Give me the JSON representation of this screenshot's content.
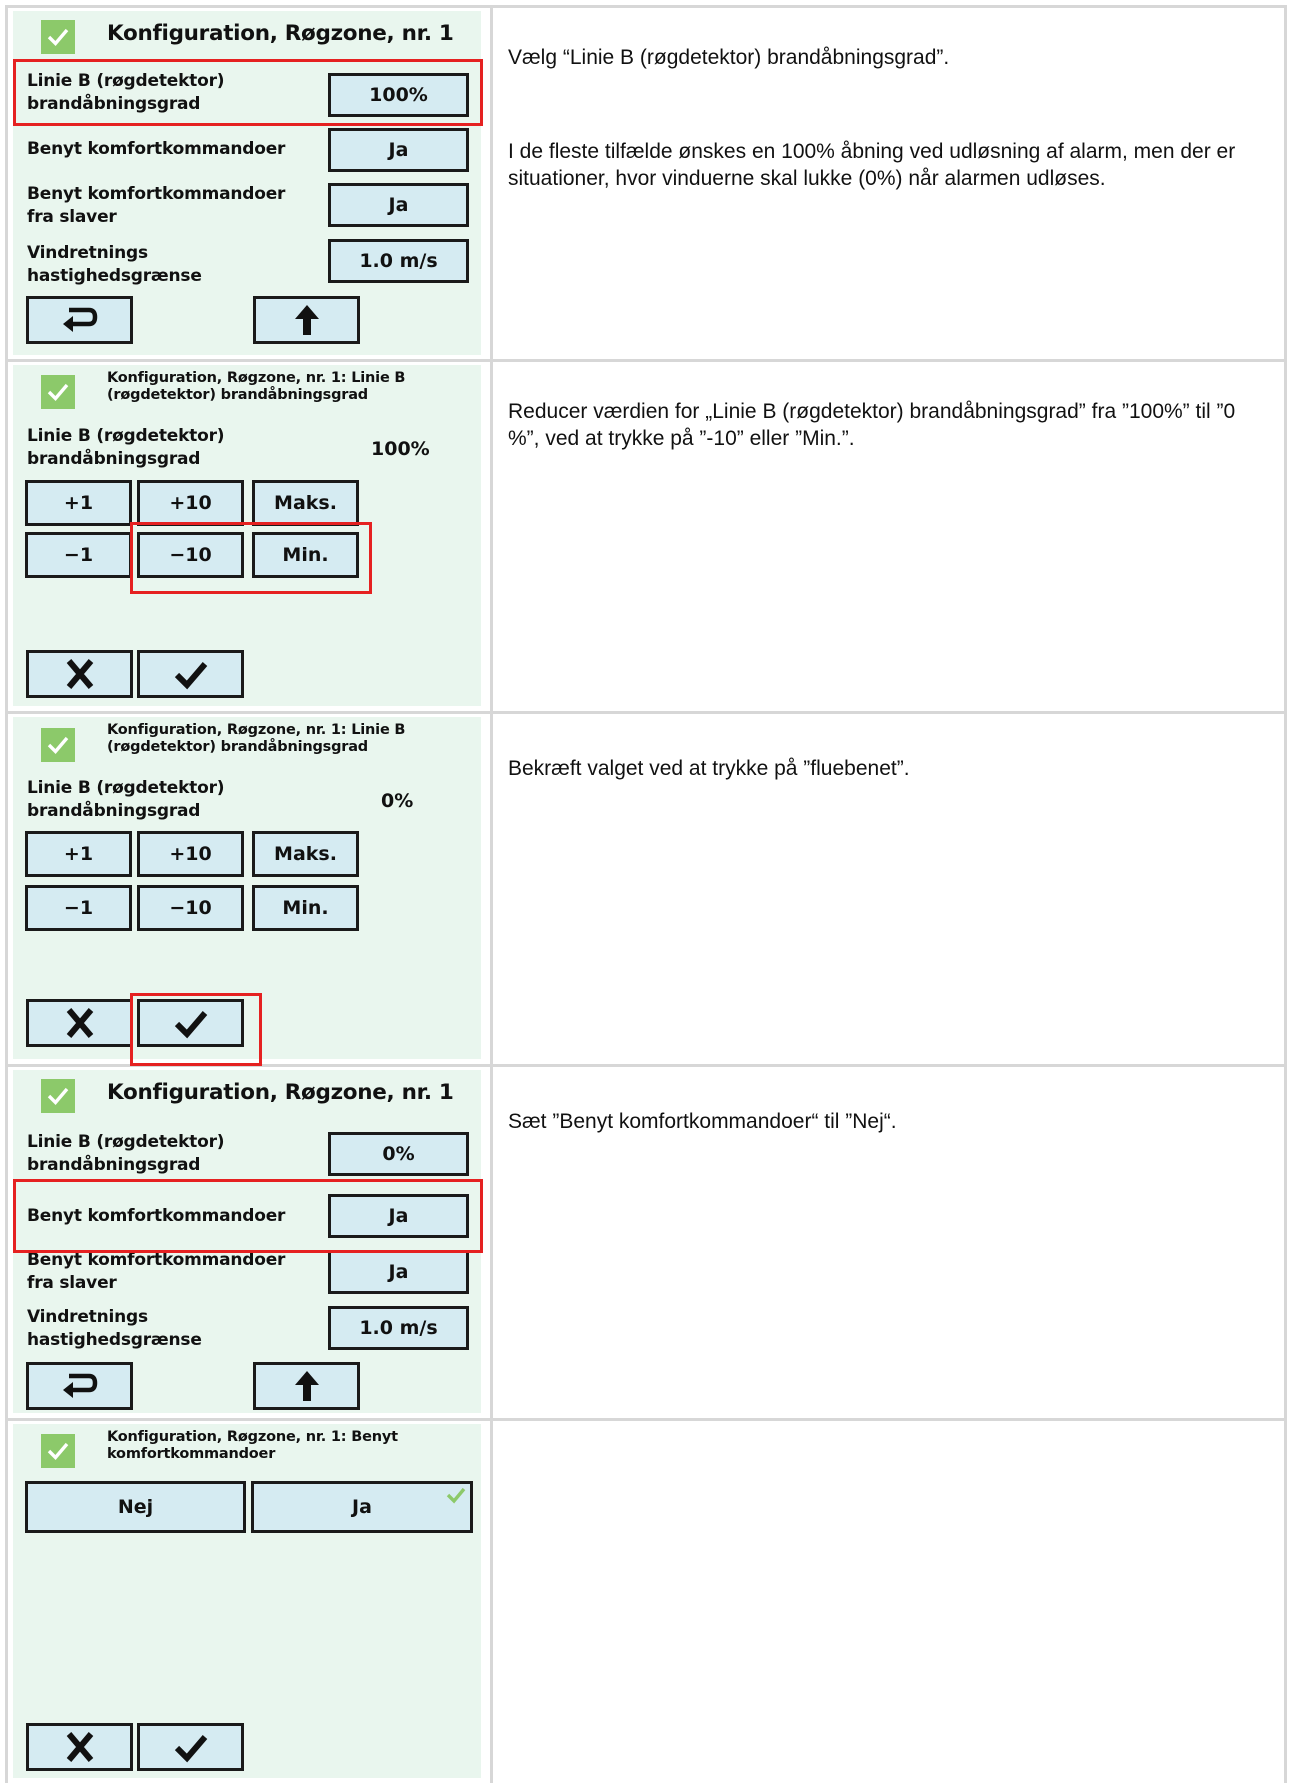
{
  "colors": {
    "screen_bg": "#e9f6ee",
    "button_bg": "#d5ebf2",
    "accent_green": "#8cc96a",
    "highlight_red": "#e52121",
    "grid_line": "#d7d7d7"
  },
  "icons": {
    "title": "green-check-icon",
    "back": "return-arrow-icon",
    "up": "up-arrow-icon",
    "cancel": "x-icon",
    "confirm": "checkmark-icon"
  },
  "rows": [
    {
      "screen": {
        "title": "Konfiguration, Røgzone, nr. 1",
        "settings": [
          {
            "label": "Linie B (røgdetektor)\nbrandåbningsgrad",
            "value": "100%"
          },
          {
            "label": "Benyt komfortkommandoer",
            "value": "Ja"
          },
          {
            "label": "Benyt komfortkommandoer\nfra slaver",
            "value": "Ja"
          },
          {
            "label": "Vindretnings\nhastighedsgrænse",
            "value": "1.0 m/s"
          }
        ]
      },
      "instruction": "Vælg “Linie B (røgdetektor) brandåbningsgrad”.",
      "instruction2": "I de fleste tilfælde ønskes en 100% åbning ved udløsning af alarm, men der er situationer, hvor vinduerne skal lukke (0%) når alarmen udløses."
    },
    {
      "screen": {
        "title": "Konfiguration, Røgzone, nr. 1: Linie B\n(røgdetektor) brandåbningsgrad",
        "label": "Linie B (røgdetektor)\nbrandåbningsgrad",
        "value": "100%",
        "keys": [
          "+1",
          "+10",
          "Maks.",
          "−1",
          "−10",
          "Min."
        ]
      },
      "instruction": "Reducer værdien for „Linie B (røgdetektor) brandåbningsgrad” fra ”100%” til ”0 %”, ved at trykke på ”-10” eller ”Min.”."
    },
    {
      "screen": {
        "title": "Konfiguration, Røgzone, nr. 1: Linie B\n(røgdetektor) brandåbningsgrad",
        "label": "Linie B (røgdetektor)\nbrandåbningsgrad",
        "value": "0%",
        "keys": [
          "+1",
          "+10",
          "Maks.",
          "−1",
          "−10",
          "Min."
        ]
      },
      "instruction": "Bekræft valget ved at trykke på ”fluebenet”."
    },
    {
      "screen": {
        "title": "Konfiguration, Røgzone, nr. 1",
        "settings": [
          {
            "label": "Linie B (røgdetektor)\nbrandåbningsgrad",
            "value": "0%"
          },
          {
            "label": "Benyt komfortkommandoer",
            "value": "Ja"
          },
          {
            "label": "Benyt komfortkommandoer\nfra slaver",
            "value": "Ja"
          },
          {
            "label": "Vindretnings\nhastighedsgrænse",
            "value": "1.0 m/s"
          }
        ]
      },
      "instruction": "Sæt ”Benyt komfortkommandoer“ til ”Nej“."
    },
    {
      "screen": {
        "title": "Konfiguration, Røgzone, nr. 1: Benyt\nkomfortkommandoer",
        "options": [
          "Nej",
          "Ja"
        ]
      },
      "instruction": ""
    }
  ]
}
